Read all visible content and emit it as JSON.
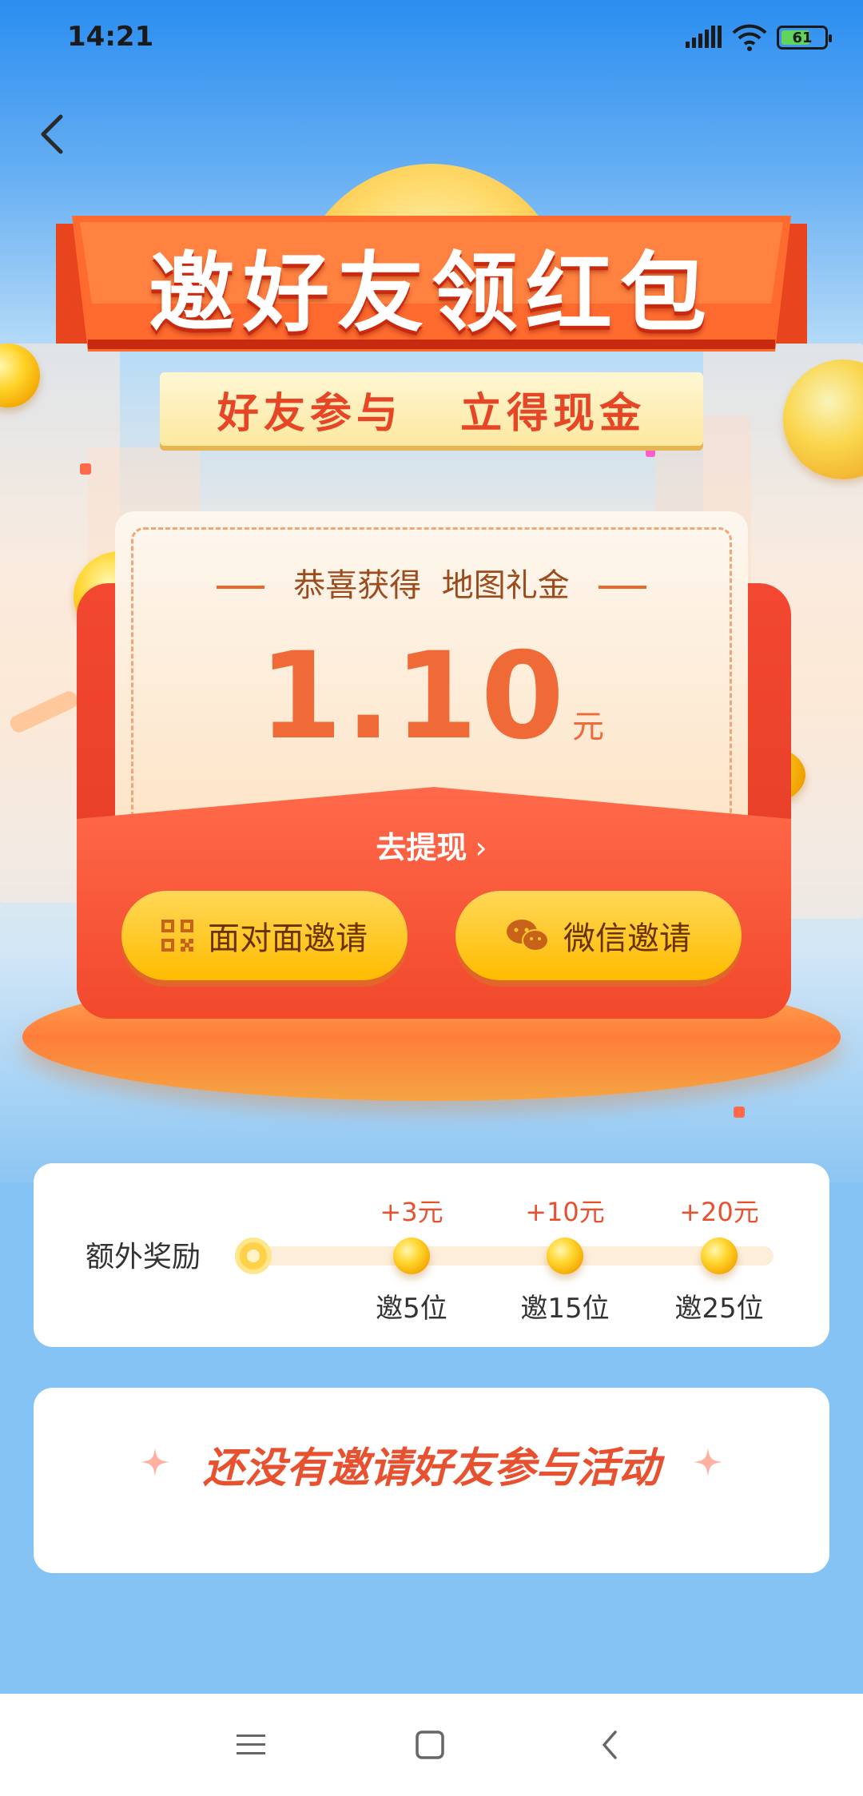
{
  "status_bar": {
    "time": "14:21",
    "battery": "61"
  },
  "header": {
    "back_icon": "chevron-left-icon"
  },
  "banner": {
    "title": "邀好友领红包",
    "subtitle": "好友参与   立得现金"
  },
  "reward_card": {
    "title": "恭喜获得  地图礼金",
    "amount": "1.10",
    "unit": "元",
    "withdraw_label": "去提现",
    "withdraw_icon": "chevron-right-icon"
  },
  "buttons": {
    "face_to_face": {
      "label": "面对面邀请",
      "icon": "qr-code-icon"
    },
    "wechat": {
      "label": "微信邀请",
      "icon": "wechat-icon"
    }
  },
  "extra_rewards": {
    "label": "额外奖励",
    "steps": [
      {
        "reward": "+3元",
        "count": "邀5位"
      },
      {
        "reward": "+10元",
        "count": "邀15位"
      },
      {
        "reward": "+20元",
        "count": "邀25位"
      }
    ]
  },
  "empty_state": {
    "text": "还没有邀请好友参与活动"
  },
  "nav": {
    "menu_icon": "menu-icon",
    "home_icon": "home-square-icon",
    "back_icon": "back-triangle-icon"
  },
  "colors": {
    "accent_red": "#e8512f",
    "gold": "#ffbc00",
    "sky": "#85c3f4"
  }
}
